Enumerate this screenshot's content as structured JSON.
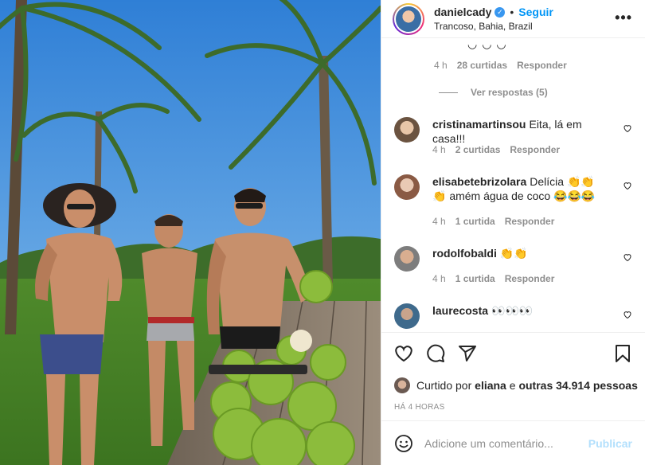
{
  "header": {
    "username": "danielcady",
    "verified_glyph": "✓",
    "separator": "•",
    "follow_label": "Seguir",
    "location": "Trancoso, Bahia, Brazil",
    "more_glyph": "•••"
  },
  "comments": {
    "top_meta": {
      "time": "4 h",
      "likes": "28 curtidas",
      "reply": "Responder"
    },
    "view_replies": "Ver respostas (5)",
    "items": [
      {
        "user": "cristinamartinsou",
        "text": "Eita, lá em casa!!!",
        "time": "4 h",
        "likes": "2 curtidas",
        "reply": "Responder",
        "avatar_color": "#c9a27d"
      },
      {
        "user": "elisabetebrizolara",
        "text": "Delícia 👏👏👏 amém água de coco 😂😂😂",
        "time": "4 h",
        "likes": "1 curtida",
        "reply": "Responder",
        "avatar_color": "#b58b78"
      },
      {
        "user": "rodolfobaldi",
        "text": "👏👏",
        "time": "4 h",
        "likes": "1 curtida",
        "reply": "Responder",
        "avatar_color": "#9e8272"
      },
      {
        "user": "laurecosta",
        "text": "👀👀👀",
        "time": "",
        "likes": "",
        "reply": "",
        "avatar_color": "#5d7a94"
      }
    ]
  },
  "likes_line": {
    "prefix": "Curtido por",
    "user": "eliana",
    "conj": "e",
    "others": "outras 34.914 pessoas"
  },
  "timestamp": "HÁ 4 HORAS",
  "composer": {
    "placeholder": "Adicione um comentário...",
    "publish_label": "Publicar"
  },
  "icons": {
    "like": "heart-icon",
    "comment": "comment-icon",
    "share": "share-icon",
    "save": "bookmark-icon",
    "emoji": "emoji-icon",
    "more": "more-options-icon",
    "verified": "verified-badge-icon"
  },
  "colors": {
    "accent": "#0095f6",
    "muted": "#8e8e8e",
    "text": "#262626",
    "publish_disabled": "#b2dffc"
  }
}
